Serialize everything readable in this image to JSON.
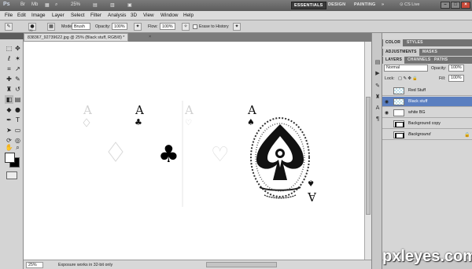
{
  "appbar": {
    "logo": "Ps",
    "zoom": "25%",
    "workspaces": [
      "ESSENTIALS",
      "DESIGN",
      "PAINTING"
    ],
    "more": "»",
    "cslive": "CS Live"
  },
  "menu": [
    "File",
    "Edit",
    "Image",
    "Layer",
    "Select",
    "Filter",
    "Analysis",
    "3D",
    "View",
    "Window",
    "Help"
  ],
  "options": {
    "brush_size": "70",
    "mode_label": "Mode:",
    "mode_value": "Brush",
    "opacity_label": "Opacity:",
    "opacity_value": "100%",
    "flow_label": "Flow:",
    "flow_value": "100%",
    "erase_history": "Erase to History"
  },
  "document": {
    "tab_title": "838367_92739622.jpg @ 25% (Black stuff, RGB/8) *",
    "close": "×"
  },
  "canvas": {
    "card_rank": "A"
  },
  "status": {
    "zoom": "25%",
    "message": "Exposure works in 32-bit only"
  },
  "panels": {
    "tabs_top": [
      "COLOR",
      "STYLES"
    ],
    "tabs_mid": [
      "ADJUSTMENTS",
      "MASKS"
    ],
    "tabs_layers": [
      "LAYERS",
      "CHANNELS",
      "PATHS"
    ],
    "blend_mode": "Normal",
    "opacity_label": "Opacity:",
    "opacity_value": "100%",
    "lock_label": "Lock:",
    "fill_label": "Fill:",
    "fill_value": "100%",
    "layers": [
      {
        "name": "Red Stuff",
        "selected": false,
        "visible": false,
        "thumb": "checker"
      },
      {
        "name": "Black stuff",
        "selected": true,
        "visible": true,
        "thumb": "checker"
      },
      {
        "name": "white BG",
        "selected": false,
        "visible": true,
        "thumb": "white"
      },
      {
        "name": "Background copy",
        "selected": false,
        "visible": false,
        "thumb": "dark"
      },
      {
        "name": "Background",
        "selected": false,
        "visible": false,
        "thumb": "dark",
        "locked": true
      }
    ]
  },
  "watermark": "pxleyes.com",
  "colors": {
    "selected_layer": "#5b7fc0",
    "canvas": "#ffffff",
    "ui_gray": "#d4d4d4"
  }
}
